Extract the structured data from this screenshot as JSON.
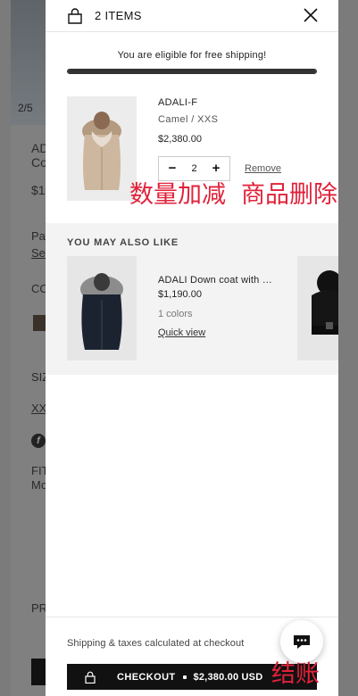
{
  "background_page": {
    "image_counter": "2/5",
    "product_name_line1": "AD",
    "product_name_line2": "Co",
    "price_partial": "$1",
    "pay_label": "Pay",
    "see_link": "See",
    "color_label": "CO",
    "size_label": "SIZ",
    "size_value": "XX",
    "fit_label": "FIT",
    "model_label": "Mo",
    "price_label": "PR"
  },
  "cart": {
    "title": "2 ITEMS",
    "shipping_message": "You are eligible for free shipping!",
    "shipping_progress": 1.0,
    "item": {
      "name": "ADALI-F",
      "variant": "Camel / XXS",
      "price": "$2,380.00",
      "quantity": "2",
      "decrease_symbol": "−",
      "increase_symbol": "+",
      "remove_label": "Remove"
    }
  },
  "recommendations": {
    "heading": "YOU MAY ALSO LIKE",
    "items": [
      {
        "name": "ADALI Down coat with …",
        "price": "$1,190.00",
        "colors": "1 colors",
        "quick_view_label": "Quick view"
      }
    ]
  },
  "footer": {
    "note": "Shipping & taxes calculated at checkout",
    "checkout_label": "CHECKOUT",
    "checkout_total": "$2,380.00 USD"
  },
  "annotations": {
    "quantity": "数量加减",
    "remove": "商品删除",
    "checkout": "结账"
  },
  "colors": {
    "accent": "#111111",
    "annotation": "#e0223a",
    "overlay": "#7b7b7b"
  },
  "icons": [
    "bag-icon",
    "close-icon",
    "lock-icon",
    "chat-icon"
  ]
}
